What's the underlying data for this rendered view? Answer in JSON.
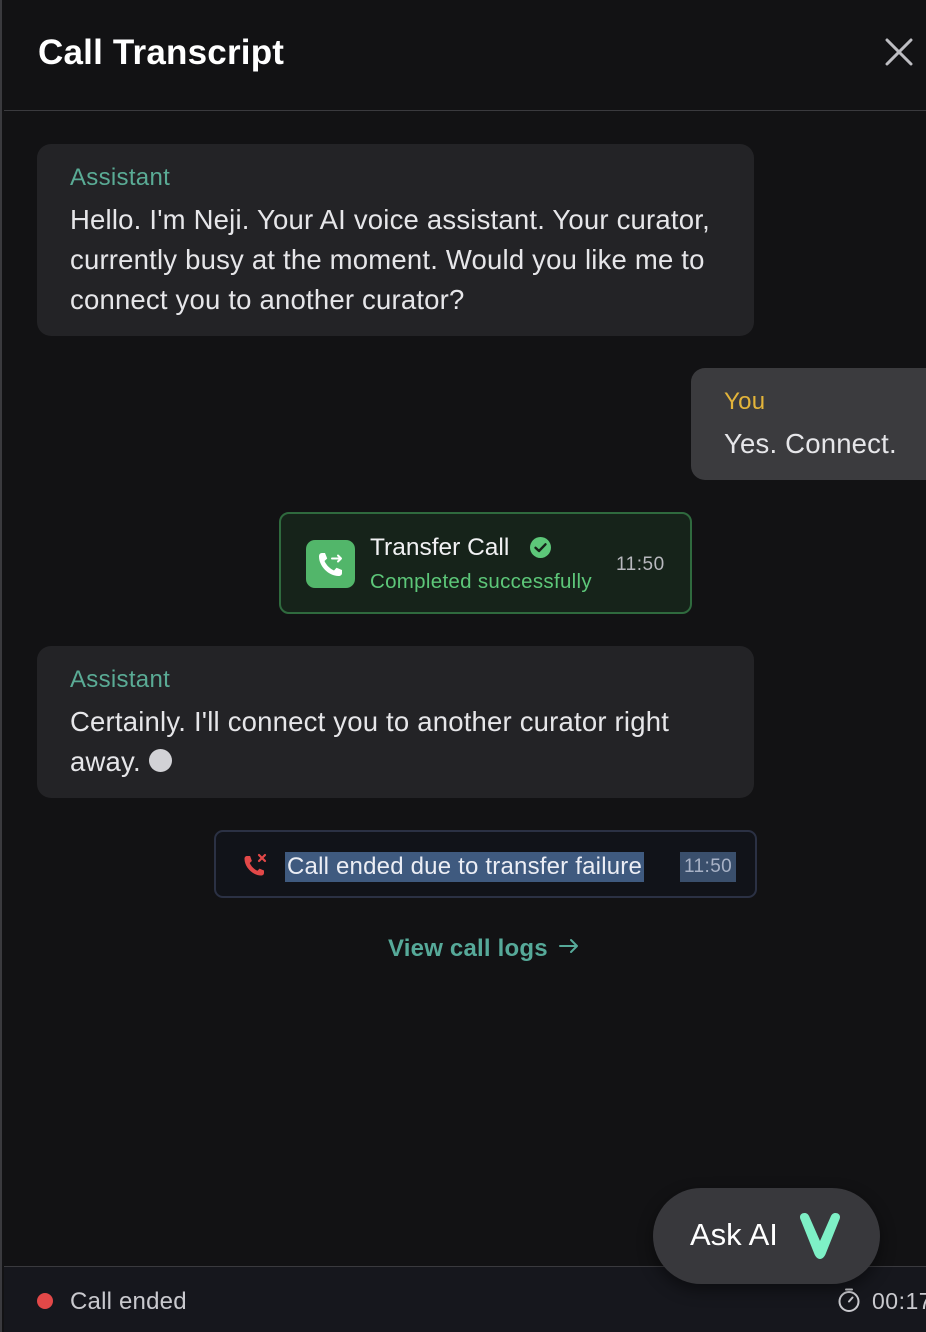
{
  "header": {
    "title": "Call Transcript",
    "close_icon": "close-icon"
  },
  "messages": [
    {
      "speaker": "Assistant",
      "text": "Hello. I'm Neji. Your AI voice assistant. Your curator, currently busy at the moment. Would you like me to connect you to another curator?"
    },
    {
      "speaker": "You",
      "text": "Yes. Connect."
    },
    {
      "speaker": "Assistant",
      "text": "Certainly. I'll connect you to another curator right away."
    }
  ],
  "transfer_event": {
    "title": "Transfer Call",
    "status": "Completed successfully",
    "time": "11:50",
    "icon": "phone-transfer-icon",
    "accent_color": "#52b66a"
  },
  "failure_event": {
    "text": "Call ended due to transfer failure",
    "time": "11:50",
    "icon": "phone-missed-icon",
    "accent_color": "#e24848"
  },
  "view_logs_label": "View call logs",
  "ask_ai": {
    "label": "Ask AI",
    "logo": "v-logo-icon",
    "logo_color": "#7ef0c6"
  },
  "footer": {
    "status": "Call ended",
    "status_color": "#e24848",
    "duration": "00:17"
  },
  "colors": {
    "assistant_label": "#5aab95",
    "user_label": "#e3b43a",
    "background": "#121214"
  }
}
